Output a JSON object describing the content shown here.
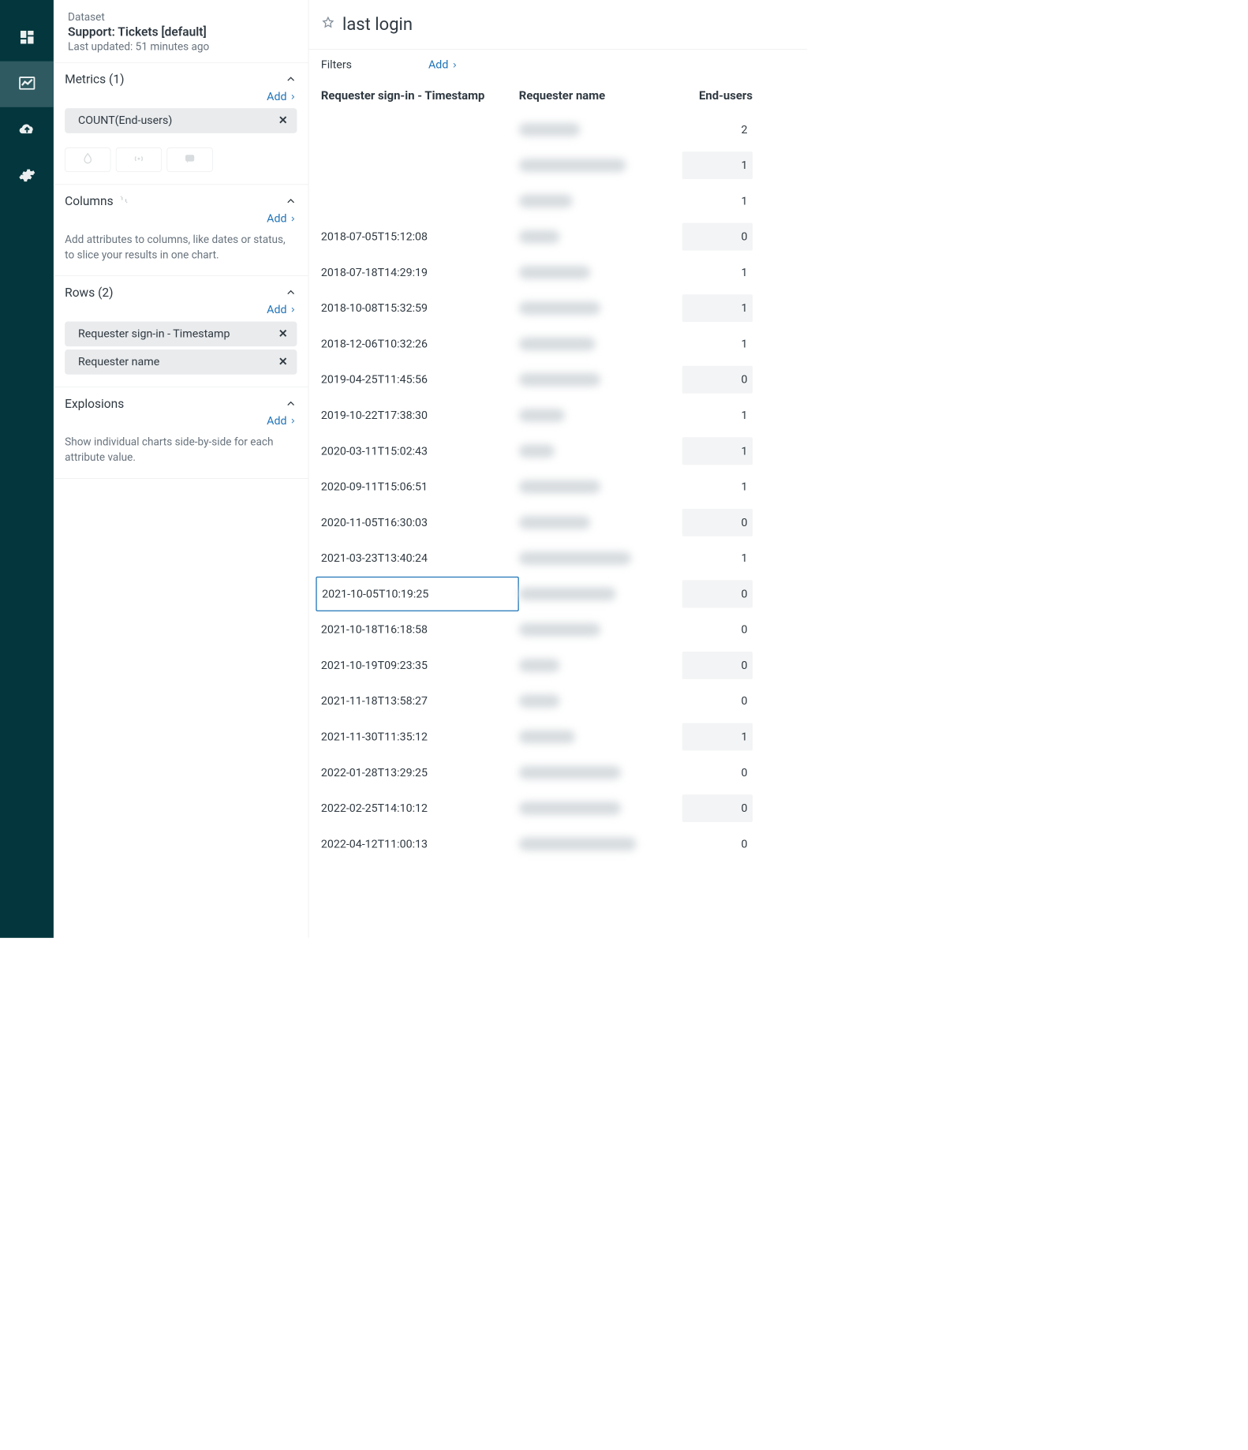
{
  "dataset": {
    "label": "Dataset",
    "name": "Support: Tickets [default]",
    "updated": "Last updated: 51 minutes ago"
  },
  "sections": {
    "metrics": {
      "title": "Metrics (1)",
      "add": "Add",
      "chips": [
        "COUNT(End-users)"
      ]
    },
    "columns": {
      "title": "Columns",
      "add": "Add",
      "hint": "Add attributes to columns, like dates or status, to slice your results in one chart."
    },
    "rows": {
      "title": "Rows (2)",
      "add": "Add",
      "chips": [
        "Requester sign-in - Timestamp",
        "Requester name"
      ]
    },
    "explosions": {
      "title": "Explosions",
      "add": "Add",
      "hint": "Show individual charts side-by-side for each attribute value."
    }
  },
  "main": {
    "title": "last login",
    "filters_label": "Filters",
    "filters_add": "Add"
  },
  "table": {
    "headers": {
      "ts": "Requester sign-in - Timestamp",
      "name": "Requester name",
      "end": "End-users"
    },
    "rows": [
      {
        "ts": "",
        "name_blur_w": 120,
        "end": 2,
        "shaded": false,
        "selected": false
      },
      {
        "ts": "",
        "name_blur_w": 210,
        "end": 1,
        "shaded": true,
        "selected": false
      },
      {
        "ts": "",
        "name_blur_w": 105,
        "end": 1,
        "shaded": false,
        "selected": false
      },
      {
        "ts": "2018-07-05T15:12:08",
        "name_blur_w": 80,
        "end": 0,
        "shaded": true,
        "selected": false
      },
      {
        "ts": "2018-07-18T14:29:19",
        "name_blur_w": 140,
        "end": 1,
        "shaded": false,
        "selected": false
      },
      {
        "ts": "2018-10-08T15:32:59",
        "name_blur_w": 160,
        "end": 1,
        "shaded": true,
        "selected": false
      },
      {
        "ts": "2018-12-06T10:32:26",
        "name_blur_w": 150,
        "end": 1,
        "shaded": false,
        "selected": false
      },
      {
        "ts": "2019-04-25T11:45:56",
        "name_blur_w": 160,
        "end": 0,
        "shaded": true,
        "selected": false
      },
      {
        "ts": "2019-10-22T17:38:30",
        "name_blur_w": 90,
        "end": 1,
        "shaded": false,
        "selected": false
      },
      {
        "ts": "2020-03-11T15:02:43",
        "name_blur_w": 70,
        "end": 1,
        "shaded": true,
        "selected": false
      },
      {
        "ts": "2020-09-11T15:06:51",
        "name_blur_w": 160,
        "end": 1,
        "shaded": false,
        "selected": false
      },
      {
        "ts": "2020-11-05T16:30:03",
        "name_blur_w": 140,
        "end": 0,
        "shaded": true,
        "selected": false
      },
      {
        "ts": "2021-03-23T13:40:24",
        "name_blur_w": 220,
        "end": 1,
        "shaded": false,
        "selected": false
      },
      {
        "ts": "2021-10-05T10:19:25",
        "name_blur_w": 190,
        "end": 0,
        "shaded": true,
        "selected": true
      },
      {
        "ts": "2021-10-18T16:18:58",
        "name_blur_w": 160,
        "end": 0,
        "shaded": false,
        "selected": false
      },
      {
        "ts": "2021-10-19T09:23:35",
        "name_blur_w": 80,
        "end": 0,
        "shaded": true,
        "selected": false
      },
      {
        "ts": "2021-11-18T13:58:27",
        "name_blur_w": 80,
        "end": 0,
        "shaded": false,
        "selected": false
      },
      {
        "ts": "2021-11-30T11:35:12",
        "name_blur_w": 110,
        "end": 1,
        "shaded": true,
        "selected": false
      },
      {
        "ts": "2022-01-28T13:29:25",
        "name_blur_w": 200,
        "end": 0,
        "shaded": false,
        "selected": false
      },
      {
        "ts": "2022-02-25T14:10:12",
        "name_blur_w": 200,
        "end": 0,
        "shaded": true,
        "selected": false
      },
      {
        "ts": "2022-04-12T11:00:13",
        "name_blur_w": 230,
        "end": 0,
        "shaded": false,
        "selected": false
      }
    ]
  }
}
